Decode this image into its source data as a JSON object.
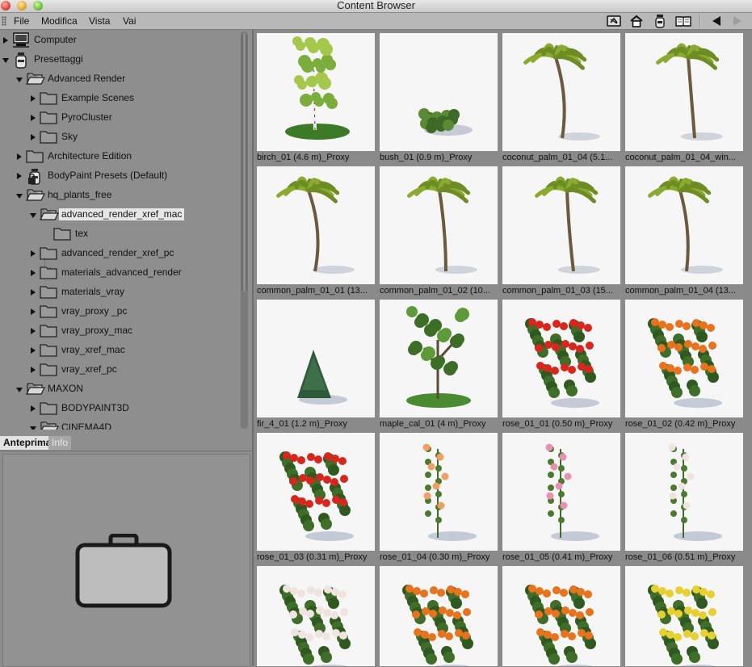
{
  "window": {
    "title": "Content Browser"
  },
  "menu": {
    "items": [
      "File",
      "Modifica",
      "Vista",
      "Vai"
    ]
  },
  "toolbar": {
    "icons": [
      "sync-icon",
      "home-icon",
      "preset-library-icon",
      "book-icon",
      "back-arrow-icon",
      "forward-arrow-icon"
    ]
  },
  "tree": {
    "items": [
      {
        "label": "Computer",
        "icon": "computer-icon",
        "state": "closed"
      },
      {
        "label": "Presettaggi",
        "icon": "presets-jar-icon",
        "state": "open"
      },
      {
        "label": "Advanced Render",
        "icon": "folder-open-icon",
        "state": "open"
      },
      {
        "label": "Example Scenes",
        "icon": "folder-icon",
        "state": "closed"
      },
      {
        "label": "PyroCluster",
        "icon": "folder-icon",
        "state": "closed"
      },
      {
        "label": "Sky",
        "icon": "folder-icon",
        "state": "closed"
      },
      {
        "label": "Architecture Edition",
        "icon": "folder-icon",
        "state": "closed"
      },
      {
        "label": "BodyPaint Presets (Default)",
        "icon": "locked-jar-icon",
        "state": "closed"
      },
      {
        "label": "hq_plants_free",
        "icon": "folder-open-icon",
        "state": "open"
      },
      {
        "label": "advanced_render_xref_mac",
        "icon": "folder-open-icon",
        "state": "open",
        "selected": true
      },
      {
        "label": "tex",
        "icon": "folder-icon",
        "state": "none"
      },
      {
        "label": "advanced_render_xref_pc",
        "icon": "folder-icon",
        "state": "closed"
      },
      {
        "label": "materials_advanced_render",
        "icon": "folder-icon",
        "state": "closed"
      },
      {
        "label": "materials_vray",
        "icon": "folder-icon",
        "state": "closed"
      },
      {
        "label": "vray_proxy _pc",
        "icon": "folder-icon",
        "state": "closed"
      },
      {
        "label": "vray_proxy_mac",
        "icon": "folder-icon",
        "state": "closed"
      },
      {
        "label": "vray_xref_mac",
        "icon": "folder-icon",
        "state": "closed"
      },
      {
        "label": "vray_xref_pc",
        "icon": "folder-icon",
        "state": "closed"
      },
      {
        "label": "MAXON",
        "icon": "folder-open-icon",
        "state": "open"
      },
      {
        "label": "BODYPAINT3D",
        "icon": "folder-icon",
        "state": "closed"
      },
      {
        "label": "CINEMA4D",
        "icon": "folder-open-icon",
        "state": "open"
      }
    ]
  },
  "tabs": {
    "preview": "Anteprima",
    "info": "Info"
  },
  "preview": {
    "icon": "briefcase-icon"
  },
  "items": [
    {
      "label": "birch_01 (4.6 m)_Proxy",
      "kind": "birch"
    },
    {
      "label": "bush_01 (0.9 m)_Proxy",
      "kind": "bush"
    },
    {
      "label": "coconut_palm_01_04 (5.1...",
      "kind": "palm"
    },
    {
      "label": "coconut_palm_01_04_win...",
      "kind": "palm"
    },
    {
      "label": "common_palm_01_01 (13...",
      "kind": "palm"
    },
    {
      "label": "common_palm_01_02 (10...",
      "kind": "palm"
    },
    {
      "label": "common_palm_01_03 (15...",
      "kind": "palm"
    },
    {
      "label": "common_palm_01_04 (13...",
      "kind": "palm"
    },
    {
      "label": "fir_4_01 (1.2 m)_Proxy",
      "kind": "fir"
    },
    {
      "label": "maple_cal_01 (4 m)_Proxy",
      "kind": "maple"
    },
    {
      "label": "rose_01_01 (0.50 m)_Proxy",
      "kind": "rose-red"
    },
    {
      "label": "rose_01_02 (0.42 m)_Proxy",
      "kind": "rose-orange"
    },
    {
      "label": "rose_01_03 (0.31 m)_Proxy",
      "kind": "rose-red"
    },
    {
      "label": "rose_01_04 (0.30 m)_Proxy",
      "kind": "rose-peach"
    },
    {
      "label": "rose_01_05 (0.41 m)_Proxy",
      "kind": "rose-pink"
    },
    {
      "label": "rose_01_06 (0.51 m)_Proxy",
      "kind": "rose-white"
    },
    {
      "label": "",
      "kind": "rose-white"
    },
    {
      "label": "",
      "kind": "rose-orange"
    },
    {
      "label": "",
      "kind": "rose-orange"
    },
    {
      "label": "",
      "kind": "rose-yellow"
    }
  ],
  "colors": {
    "rose-red": "#d8261c",
    "rose-orange": "#e8731c",
    "rose-peach": "#f0a060",
    "rose-pink": "#e890b0",
    "rose-white": "#f0e4e0",
    "rose-yellow": "#e8d030",
    "leaf": "#3f6e28",
    "palm": "#7a9a2a"
  }
}
